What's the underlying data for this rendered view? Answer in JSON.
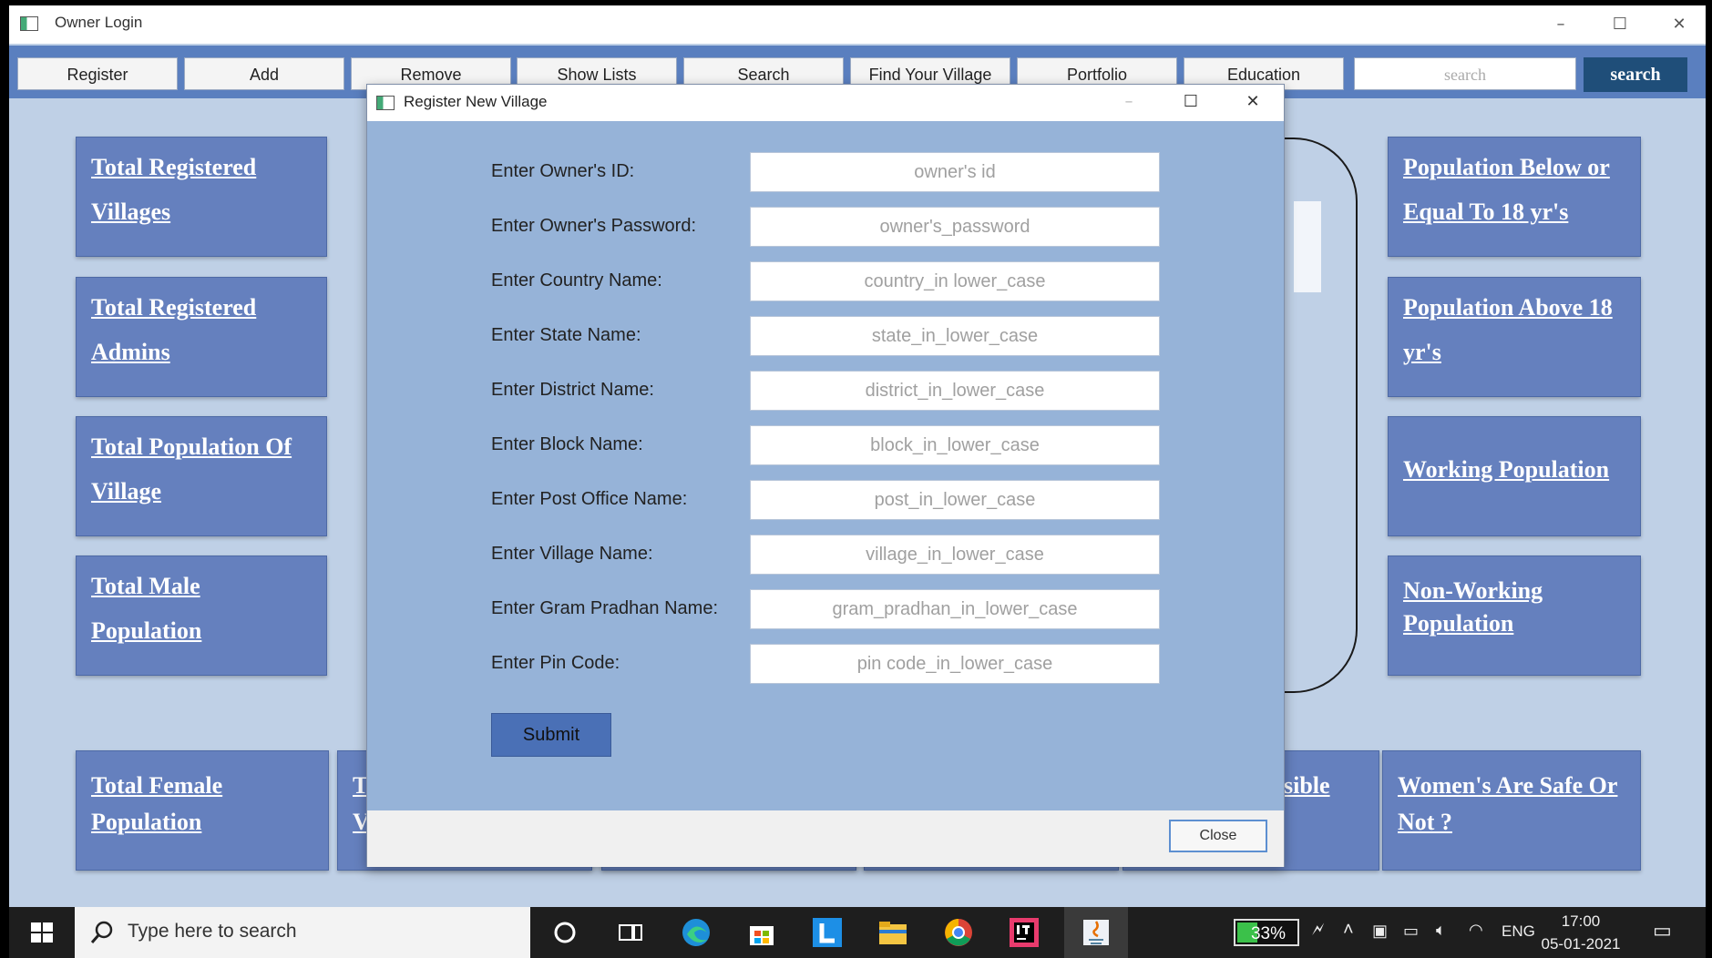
{
  "window": {
    "title": "Owner Login"
  },
  "nav": {
    "buttons": [
      "Register",
      "Add",
      "Remove",
      "Show Lists",
      "Search",
      "Find Your Village",
      "Portfolio",
      "Education"
    ],
    "search_placeholder": "search",
    "search_button": "search"
  },
  "cards": {
    "left": [
      [
        "Total Registered",
        "Villages"
      ],
      [
        "Total Registered",
        "Admins"
      ],
      [
        "Total Population Of",
        "Village"
      ],
      [
        "Total Male",
        "Population"
      ]
    ],
    "right": [
      [
        "Population Below or",
        "Equal To 18 yr's"
      ],
      [
        "Population Above 18",
        "yr's"
      ],
      [
        "Working Population"
      ],
      [
        "Non-Working",
        "Population"
      ]
    ],
    "bottom": {
      "female": [
        "Total Female",
        "Population"
      ],
      "partial_left": [
        "T",
        "V"
      ],
      "partial_right": "sible",
      "women": [
        "Women's Are Safe Or",
        "Not ?"
      ]
    }
  },
  "dialog": {
    "title": "Register New Village",
    "fields": [
      {
        "label": "Enter Owner's ID:",
        "placeholder": "owner's id"
      },
      {
        "label": "Enter Owner's Password:",
        "placeholder": "owner's_password"
      },
      {
        "label": "Enter Country Name:",
        "placeholder": "country_in lower_case"
      },
      {
        "label": "Enter State Name:",
        "placeholder": "state_in_lower_case"
      },
      {
        "label": "Enter District Name:",
        "placeholder": "district_in_lower_case"
      },
      {
        "label": "Enter Block Name:",
        "placeholder": "block_in_lower_case"
      },
      {
        "label": "Enter Post Office Name:",
        "placeholder": "post_in_lower_case"
      },
      {
        "label": "Enter Village Name:",
        "placeholder": "village_in_lower_case"
      },
      {
        "label": "Enter Gram Pradhan Name:",
        "placeholder": "gram_pradhan_in_lower_case"
      },
      {
        "label": "Enter Pin Code:",
        "placeholder": "pin code_in_lower_case"
      }
    ],
    "submit": "Submit",
    "close": "Close"
  },
  "taskbar": {
    "search_placeholder": "Type here to search",
    "battery": "33%",
    "language": "ENG",
    "time": "17:00",
    "date": "05-01-2021",
    "icons": [
      "cortana-icon",
      "task-view-icon",
      "edge-icon",
      "store-icon",
      "l-app-icon",
      "file-explorer-icon",
      "chrome-icon",
      "intellij-icon",
      "java-icon"
    ]
  }
}
